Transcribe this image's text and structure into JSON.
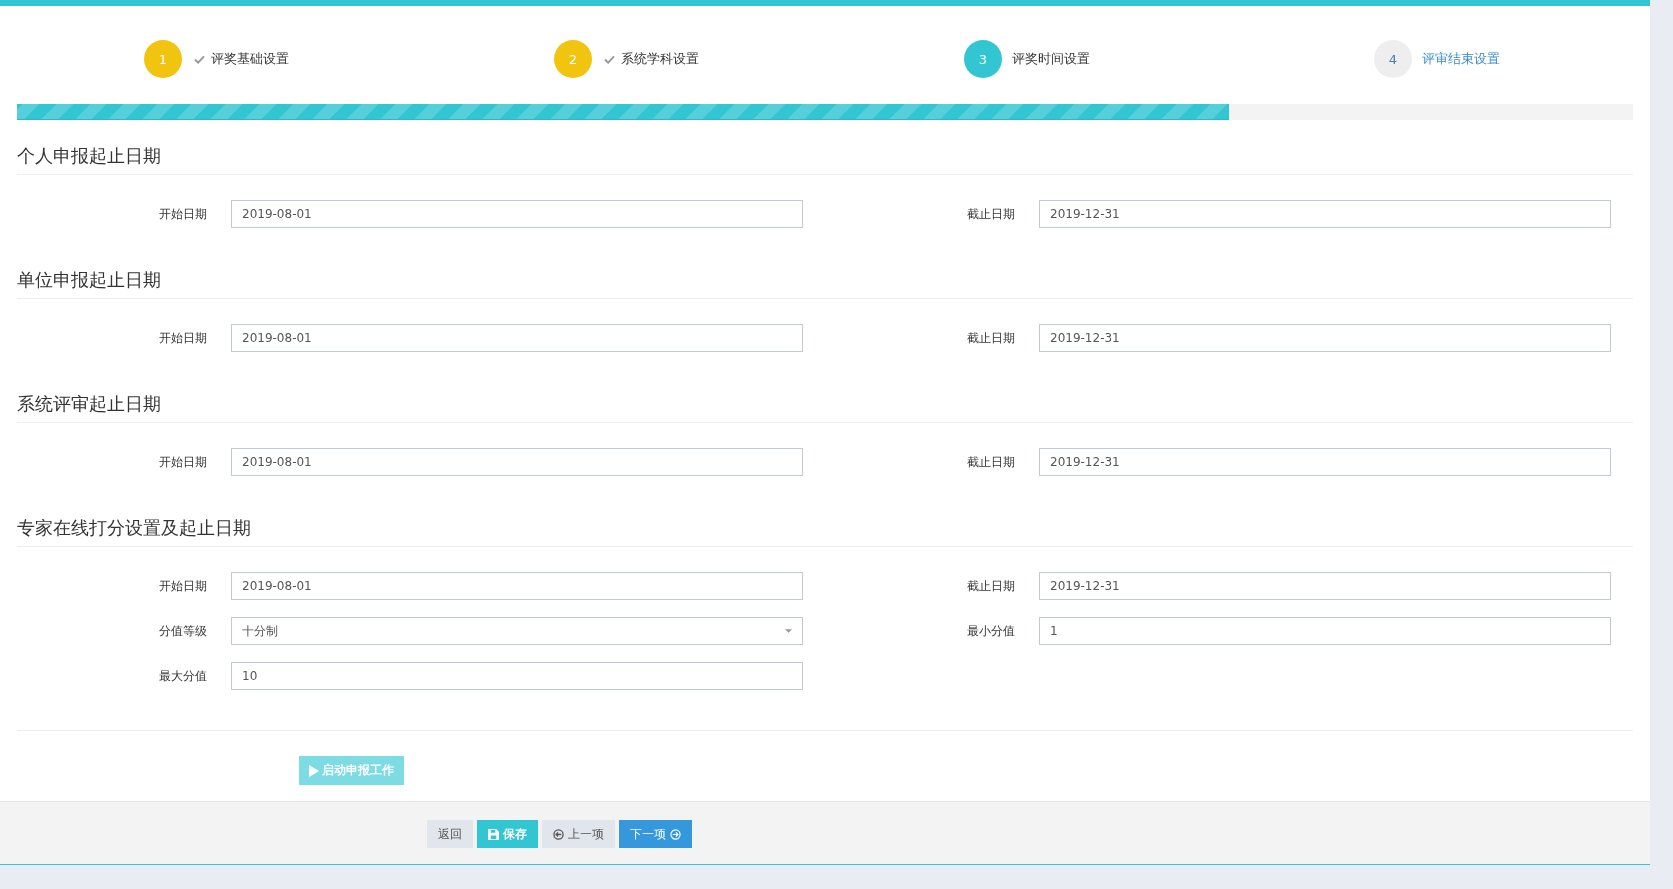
{
  "steps": [
    {
      "number": "1",
      "label": "评奖基础设置",
      "kind": "done"
    },
    {
      "number": "2",
      "label": "系统学科设置",
      "kind": "done"
    },
    {
      "number": "3",
      "label": "评奖时间设置",
      "kind": "current"
    },
    {
      "number": "4",
      "label": "评审结束设置",
      "kind": "todo"
    }
  ],
  "progress": {
    "level": 0.75
  },
  "sections": [
    {
      "title": "个人申报起止日期",
      "fields": [
        {
          "label": "开始日期",
          "value": "2019-08-01",
          "kind": "text"
        },
        {
          "label": "截止日期",
          "value": "2019-12-31",
          "kind": "text"
        }
      ]
    },
    {
      "title": "单位申报起止日期",
      "fields": [
        {
          "label": "开始日期",
          "value": "2019-08-01",
          "kind": "text"
        },
        {
          "label": "截止日期",
          "value": "2019-12-31",
          "kind": "text"
        }
      ]
    },
    {
      "title": "系统评审起止日期",
      "fields": [
        {
          "label": "开始日期",
          "value": "2019-08-01",
          "kind": "text"
        },
        {
          "label": "截止日期",
          "value": "2019-12-31",
          "kind": "text"
        }
      ]
    },
    {
      "title": "专家在线打分设置及起止日期",
      "fields": [
        {
          "label": "开始日期",
          "value": "2019-08-01",
          "kind": "text"
        },
        {
          "label": "截止日期",
          "value": "2019-12-31",
          "kind": "text"
        },
        {
          "label": "分值等级",
          "value": "十分制",
          "kind": "select"
        },
        {
          "label": "最小分值",
          "value": "1",
          "kind": "text"
        },
        {
          "label": "最大分值",
          "value": "10",
          "kind": "text"
        }
      ]
    }
  ],
  "start_button": {
    "label": "启动申报工作",
    "disabled": true
  },
  "footer_buttons": [
    {
      "label": "返回",
      "kind": "back"
    },
    {
      "label": "保存",
      "kind": "save"
    },
    {
      "label": "上一项",
      "kind": "prev"
    },
    {
      "label": "下一项",
      "kind": "next"
    }
  ]
}
